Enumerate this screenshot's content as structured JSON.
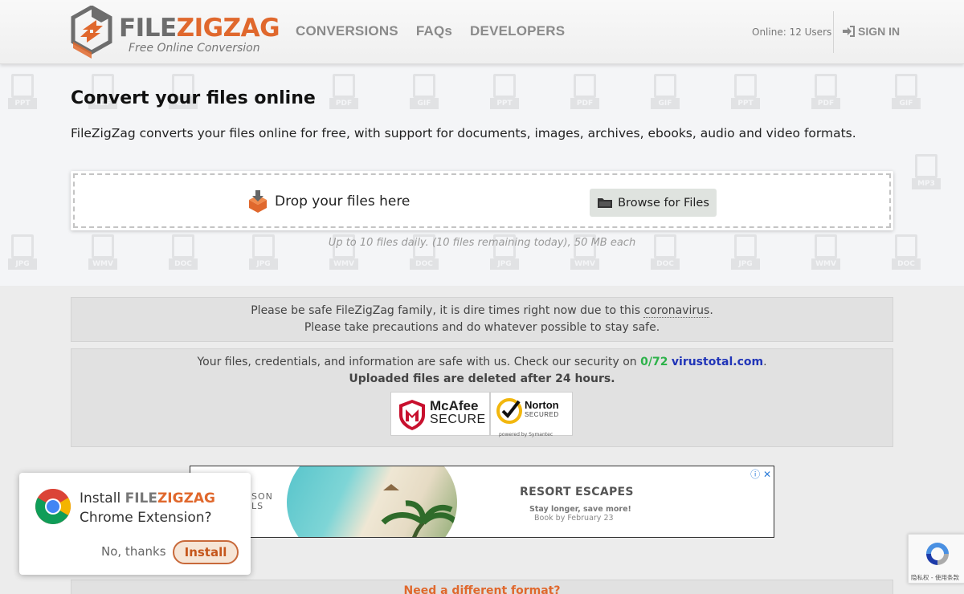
{
  "header": {
    "logo_word_1": "FILE",
    "logo_word_2": "ZIGZAG",
    "logo_tagline": "Free Online Conversion",
    "nav": [
      "CONVERSIONS",
      "FAQs",
      "DEVELOPERS"
    ],
    "online_users": "Online: 12 Users",
    "signin_label": "SIGN IN"
  },
  "hero": {
    "title": "Convert your files online",
    "description": "FileZigZag converts your files online for free, with support for documents, images, archives, ebooks, audio and video formats.",
    "drop_label": "Drop your files here",
    "browse_label": "Browse for Files",
    "limit_text": "Up to 10 files daily. (10 files remaining today), 50 MB each",
    "watermark_labels": [
      "PPT",
      "PDF",
      "GIF",
      "PPT",
      "PDF",
      "GIF",
      "PPT",
      "PDF",
      "GIF",
      "MP3",
      "JPG",
      "WMV",
      "DOC",
      "JPG",
      "WMV",
      "DOC",
      "JPG",
      "WMV",
      "DOC",
      "JPG",
      "WMV",
      "DOC"
    ]
  },
  "notice": {
    "line1_prefix": "Please be safe FileZigZag family, it is dire times right now due to this ",
    "line1_link": "coronavirus",
    "line1_suffix": ".",
    "line2": "Please take precautions and do whatever possible to stay safe."
  },
  "security": {
    "line1_prefix": "Your files, credentials, and information are safe with us. Check our security on ",
    "score": "0/72",
    "link": "virustotal.com",
    "line1_suffix": ".",
    "line2": "Uploaded files are deleted after 24 hours.",
    "mcafee_1": "McAfee",
    "mcafee_2": "SECURE",
    "norton_1": "Norton",
    "norton_2": "SECURED",
    "norton_powered": "powered by Symantec"
  },
  "ad": {
    "brand_1": "SSON",
    "brand_2": "ELS",
    "title": "RESORT ESCAPES",
    "subtitle": "Stay longer, save more!",
    "subtitle2": "Book by February 23",
    "icons": "ⓘ ✕"
  },
  "popup": {
    "line1_prefix": "Install ",
    "brand_1": "FILE",
    "brand_2": "ZIGZAG",
    "line2": "Chrome Extension?",
    "no_thanks": "No, thanks",
    "install": "Install"
  },
  "recaptcha": {
    "text": "隐私权 - 使用条款"
  },
  "footer": {
    "text": "Need a different format?"
  },
  "colors": {
    "brand_orange": "#e0682d",
    "brand_gray": "#6d6d6d",
    "green": "#2db24a",
    "link_blue": "#2135b8"
  }
}
